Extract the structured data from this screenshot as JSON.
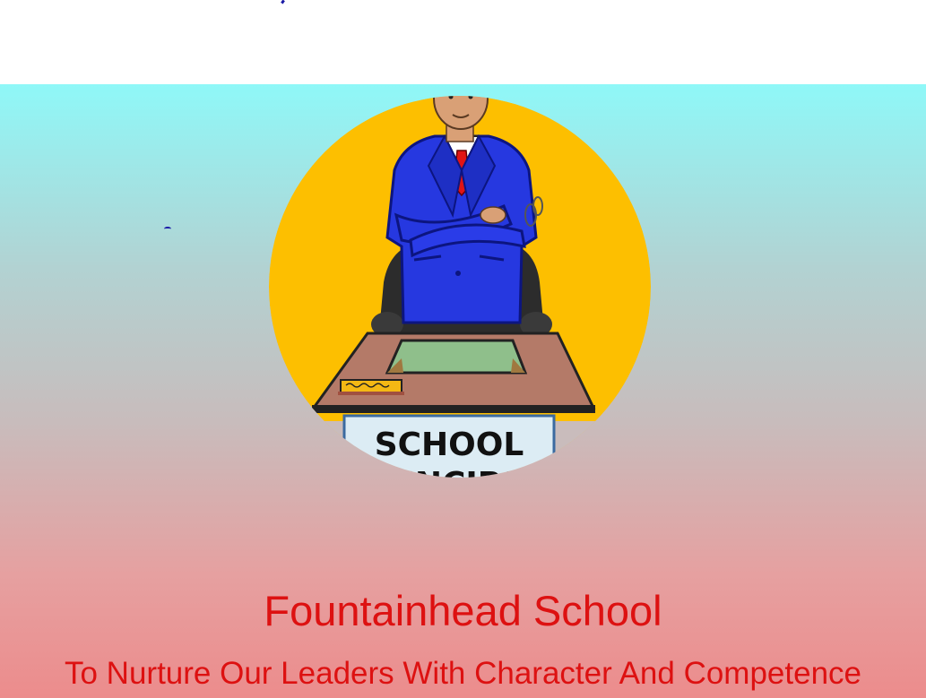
{
  "colors": {
    "heading": "#dd1111",
    "gradient_top": "#8ff8f8",
    "gradient_bottom": "#ec8c8c",
    "sun_circle": "#fdbf00",
    "suit": "#2638e0"
  },
  "hero": {
    "image": {
      "icon": "school-principal-illustration",
      "sign_line1": "SCHOOL",
      "sign_line2": "PRINCIPAL"
    },
    "school_name": "Fountainhead School",
    "tagline": "To Nurture Our Leaders With Character And Competence"
  }
}
